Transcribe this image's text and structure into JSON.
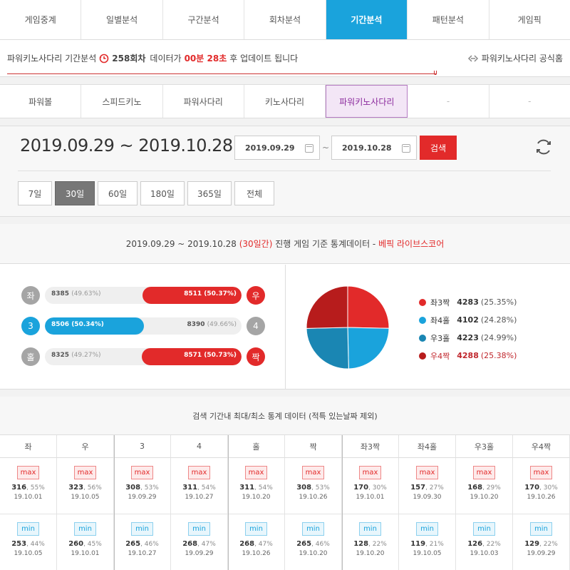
{
  "nav": {
    "tabs": [
      "게임중계",
      "일별분석",
      "구간분석",
      "회차분석",
      "기간분석",
      "패턴분석",
      "게임픽"
    ],
    "active": 4
  },
  "info": {
    "prefix": "파워키노사다리 기간분석",
    "round": "258회차",
    "mid": "데이터가",
    "timer": "00분 28초",
    "suffix": "후 업데이트 됩니다",
    "official": "파워키노사다리 공식홈",
    "progress": 1
  },
  "games": {
    "tabs": [
      "파워볼",
      "스피드키노",
      "파워사다리",
      "키노사다리",
      "파워키노사다리",
      "-",
      "-"
    ],
    "active": 4
  },
  "dates": {
    "range": "2019.09.29 ~ 2019.10.28",
    "from": "2019.09.29",
    "to": "2019.10.28",
    "tilde": "~",
    "search": "검색",
    "periods": [
      "7일",
      "30일",
      "60일",
      "180일",
      "365일",
      "전체"
    ],
    "active": 1
  },
  "stats": {
    "range": "2019.09.29 ~ 2019.10.28",
    "days": "(30일간)",
    "mid": "진행 게임 기준 통계데이터 -",
    "source": "베픽 라이브스코어",
    "rows": [
      {
        "left": "좌",
        "right": "우",
        "lv": "8385",
        "lp": "(49.63%)",
        "rv": "8511",
        "rp": "(50.37%)",
        "winner": "right",
        "leftColor": "#a5a5a5",
        "rightColor": "#e22a2a",
        "fill": 0.5037
      },
      {
        "left": "3",
        "right": "4",
        "lv": "8506",
        "lp": "(50.34%)",
        "rv": "8390",
        "rp": "(49.66%)",
        "winner": "left",
        "leftColor": "#1aa3dc",
        "rightColor": "#a5a5a5",
        "fill": 0.5034
      },
      {
        "left": "홀",
        "right": "짝",
        "lv": "8325",
        "lp": "(49.27%)",
        "rv": "8571",
        "rp": "(50.73%)",
        "winner": "right",
        "leftColor": "#a5a5a5",
        "rightColor": "#e22a2a",
        "fill": 0.5073
      }
    ]
  },
  "chart_data": {
    "type": "pie",
    "slices": [
      {
        "label": "좌3짝",
        "value": 4283,
        "percent": "(25.35%)",
        "color": "#e22a2a"
      },
      {
        "label": "좌4홀",
        "value": 4102,
        "percent": "(24.28%)",
        "color": "#1aa3dc"
      },
      {
        "label": "우3홀",
        "value": 4223,
        "percent": "(24.99%)",
        "color": "#1a86b3"
      },
      {
        "label": "우4짝",
        "value": 4288,
        "percent": "(25.38%)",
        "color": "#b71c1c"
      }
    ],
    "highlight": 3
  },
  "maxmin": {
    "title": "검색 기간내 최대/최소 통계 데이터 (적특 있는날짜 제외)",
    "maxLabel": "max",
    "minLabel": "min",
    "columns": [
      "좌",
      "우",
      "3",
      "4",
      "홀",
      "짝",
      "좌3짝",
      "좌4홀",
      "우3홀",
      "우4짝"
    ],
    "max": [
      {
        "v": "316",
        "p": "55%",
        "d": "19.10.01"
      },
      {
        "v": "323",
        "p": "56%",
        "d": "19.10.05"
      },
      {
        "v": "308",
        "p": "53%",
        "d": "19.09.29"
      },
      {
        "v": "311",
        "p": "54%",
        "d": "19.10.27"
      },
      {
        "v": "311",
        "p": "54%",
        "d": "19.10.20"
      },
      {
        "v": "308",
        "p": "53%",
        "d": "19.10.26"
      },
      {
        "v": "170",
        "p": "30%",
        "d": "19.10.01"
      },
      {
        "v": "157",
        "p": "27%",
        "d": "19.09.30"
      },
      {
        "v": "168",
        "p": "29%",
        "d": "19.10.20"
      },
      {
        "v": "170",
        "p": "30%",
        "d": "19.10.26"
      }
    ],
    "min": [
      {
        "v": "253",
        "p": "44%",
        "d": "19.10.05"
      },
      {
        "v": "260",
        "p": "45%",
        "d": "19.10.01"
      },
      {
        "v": "265",
        "p": "46%",
        "d": "19.10.27"
      },
      {
        "v": "268",
        "p": "47%",
        "d": "19.09.29"
      },
      {
        "v": "268",
        "p": "47%",
        "d": "19.10.26"
      },
      {
        "v": "265",
        "p": "46%",
        "d": "19.10.20"
      },
      {
        "v": "128",
        "p": "22%",
        "d": "19.10.20"
      },
      {
        "v": "119",
        "p": "21%",
        "d": "19.10.05"
      },
      {
        "v": "126",
        "p": "22%",
        "d": "19.10.03"
      },
      {
        "v": "129",
        "p": "22%",
        "d": "19.09.29"
      }
    ]
  }
}
